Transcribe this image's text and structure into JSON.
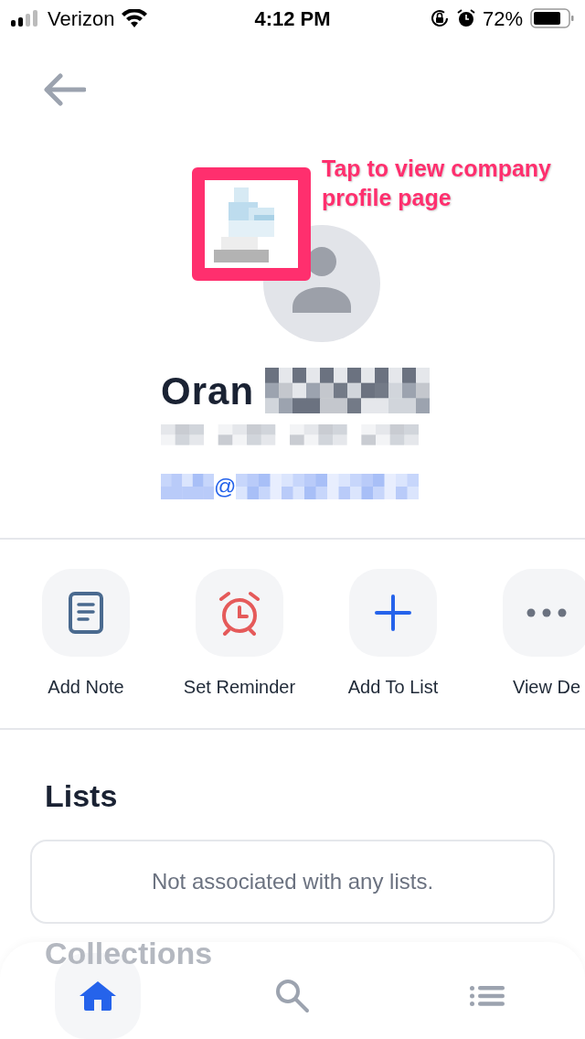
{
  "status_bar": {
    "carrier": "Verizon",
    "time": "4:12 PM",
    "battery": "72%"
  },
  "annotation": {
    "text": "Tap to view company profile page"
  },
  "profile": {
    "name": "Oran",
    "email_at": "@"
  },
  "actions": [
    {
      "kind": "note",
      "label": "Add Note"
    },
    {
      "kind": "alarm",
      "label": "Set Reminder"
    },
    {
      "kind": "plus",
      "label": "Add To List"
    },
    {
      "kind": "more",
      "label": "View De"
    }
  ],
  "lists": {
    "title": "Lists",
    "empty": "Not associated with any lists."
  },
  "collections": {
    "title": "Collections"
  },
  "nav": [
    {
      "kind": "home",
      "selected": true
    },
    {
      "kind": "search",
      "selected": false
    },
    {
      "kind": "list",
      "selected": false
    }
  ]
}
